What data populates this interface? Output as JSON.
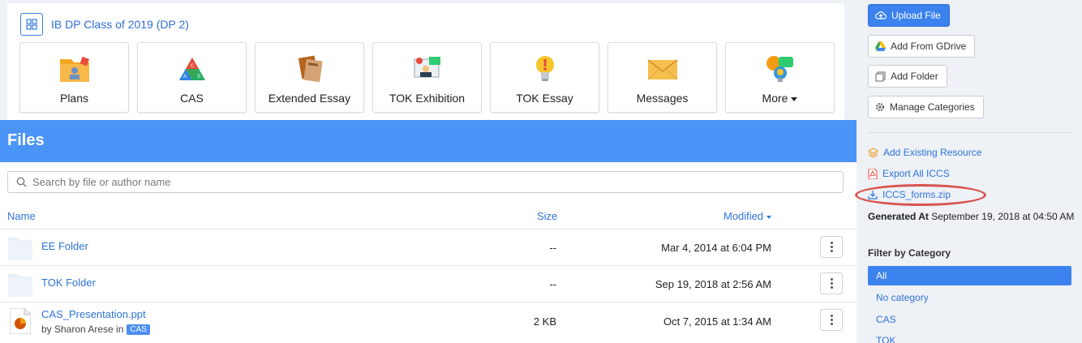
{
  "class_card": {
    "title": "IB DP Class of 2019 (DP 2)",
    "tiles": [
      {
        "label": "Plans",
        "icon": "plans-folder-icon"
      },
      {
        "label": "CAS",
        "icon": "cas-triangle-icon"
      },
      {
        "label": "Extended Essay",
        "icon": "extended-essay-books-icon"
      },
      {
        "label": "TOK Exhibition",
        "icon": "tok-exhibition-icon"
      },
      {
        "label": "TOK Essay",
        "icon": "lightbulb-icon"
      },
      {
        "label": "Messages",
        "icon": "envelope-icon"
      },
      {
        "label": "More",
        "icon": "chat-bubbles-icon"
      }
    ]
  },
  "files": {
    "title": "Files",
    "search_placeholder": "Search by file or author name",
    "columns": {
      "name": "Name",
      "size": "Size",
      "modified": "Modified"
    },
    "rows": [
      {
        "name": "EE Folder",
        "size": "--",
        "modified": "Mar 4, 2014 at 6:04 PM",
        "type": "folder"
      },
      {
        "name": "TOK Folder",
        "size": "--",
        "modified": "Sep 19, 2018 at 2:56 AM",
        "type": "folder"
      },
      {
        "name": "CAS_Presentation.ppt",
        "size": "2 KB",
        "modified": "Oct 7, 2015 at 1:34 AM",
        "type": "ppt",
        "author_prefix": "by Sharon Arese in",
        "tag": "CAS"
      }
    ]
  },
  "sidebar": {
    "upload_label": "Upload File",
    "gdrive_label": "Add From GDrive",
    "folder_label": "Add Folder",
    "categories_label": "Manage Categories",
    "existing_resource": "Add Existing Resource",
    "export_iccs": "Export All ICCS",
    "iccs_zip": "ICCS_forms.zip",
    "generated_label": "Generated At",
    "generated_value": "September 19, 2018 at 04:50 AM",
    "filter_title": "Filter by Category",
    "categories": [
      "All",
      "No category",
      "CAS",
      "TOK"
    ]
  },
  "colors": {
    "accent": "#3b82ee",
    "header": "#4b94f7",
    "highlight_oval": "#d9534f"
  }
}
